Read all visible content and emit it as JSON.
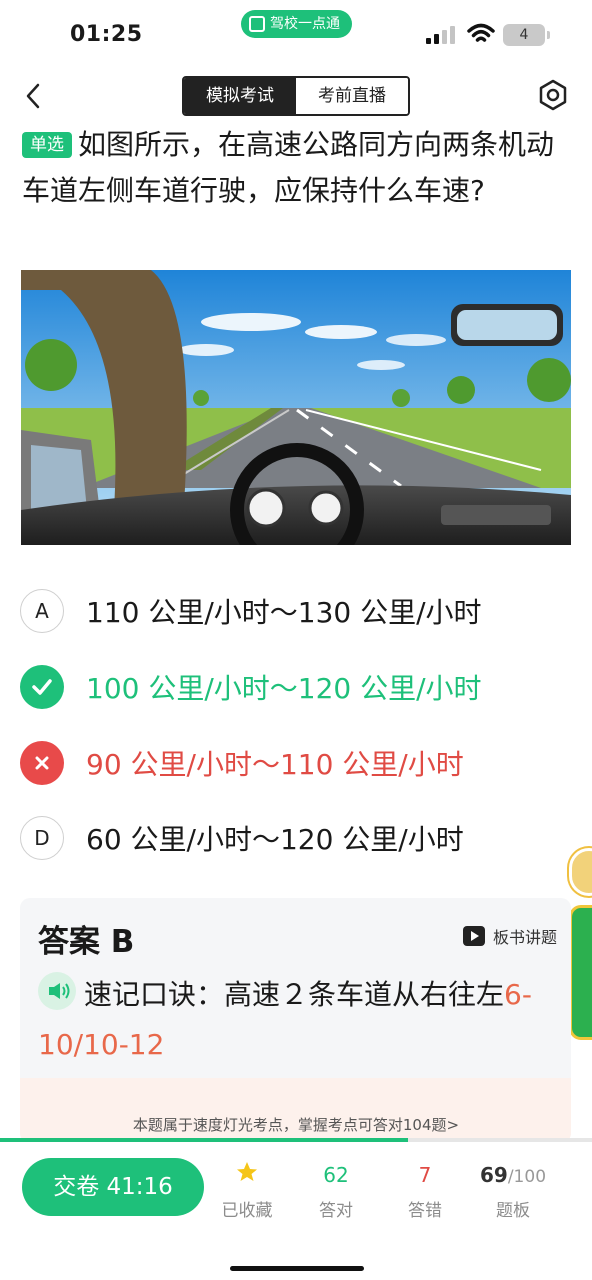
{
  "status_bar": {
    "time": "01:25",
    "app_name": "驾校一点通",
    "battery": "4",
    "icons": [
      "signal-icon",
      "wifi-icon",
      "battery-icon"
    ]
  },
  "nav": {
    "back_icon": "chevron-left-icon",
    "tabs": [
      {
        "label": "模拟考试",
        "active": true
      },
      {
        "label": "考前直播",
        "active": false
      }
    ],
    "settings_icon": "gear-icon"
  },
  "question": {
    "type": "单选",
    "text": "如图所示，在高速公路同方向两条机动车道左侧车道行驶，应保持什么车速?"
  },
  "options": [
    {
      "marker": "A",
      "state": "normal",
      "text": "110 公里/小时～130 公里/小时"
    },
    {
      "marker": "",
      "state": "correct",
      "text": "100 公里/小时～120 公里/小时"
    },
    {
      "marker": "",
      "state": "wrong",
      "text": "90 公里/小时～110 公里/小时"
    },
    {
      "marker": "D",
      "state": "normal",
      "text": "60 公里/小时～120 公里/小时"
    }
  ],
  "answer": {
    "title": "答案 B",
    "board_link": "板书讲题",
    "mnemonic_prefix": "速记口诀：高速２条车道从右往左",
    "mnemonic_highlight": "6-10/10-12",
    "hint": "本题属于速度灯光考点，掌握考点可答对104题>"
  },
  "progress": {
    "value": 0.69
  },
  "bottom": {
    "submit_label": "交卷 41:16",
    "favorite_label": "已收藏",
    "correct_count": "62",
    "correct_label": "答对",
    "wrong_count": "7",
    "wrong_label": "答错",
    "current": "69",
    "total": "/100",
    "board_label": "题板"
  },
  "colors": {
    "accent": "#1ec07a",
    "wrong": "#e04b44",
    "highlight": "#e8684a"
  }
}
